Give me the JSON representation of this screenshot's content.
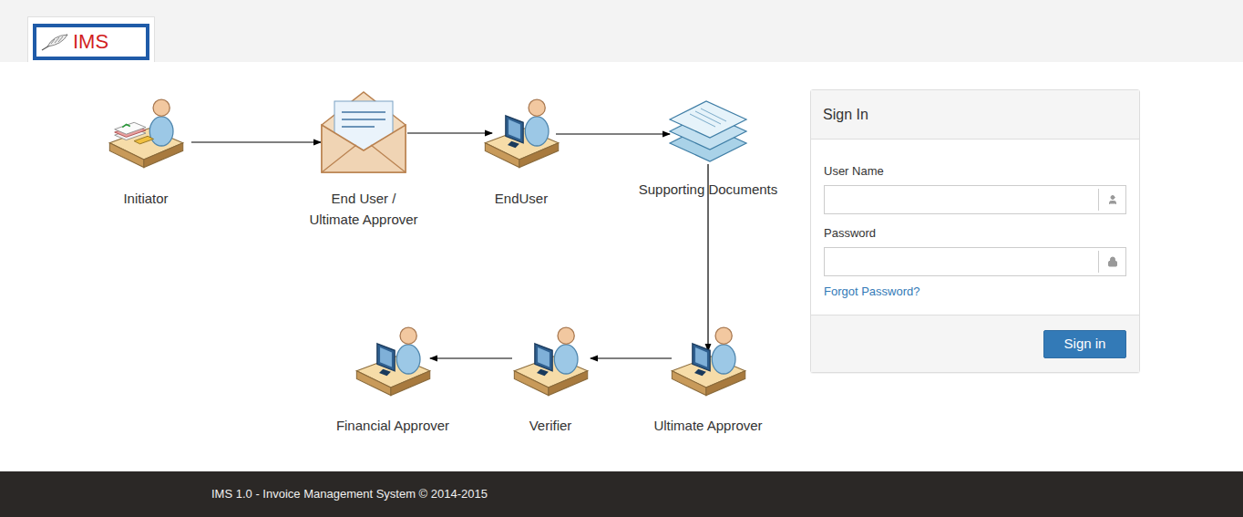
{
  "header": {
    "logo": "IMS"
  },
  "diagram": {
    "nodes": [
      {
        "label": [
          "Initiator"
        ],
        "kind": "initiator"
      },
      {
        "label": [
          "End User /",
          "Ultimate Approver"
        ],
        "kind": "envelope"
      },
      {
        "label": [
          "EndUser"
        ],
        "kind": "computer"
      },
      {
        "label": [
          "Supporting Documents"
        ],
        "kind": "documents"
      },
      {
        "label": [
          "Ultimate Approver"
        ],
        "kind": "computer"
      },
      {
        "label": [
          "Verifier"
        ],
        "kind": "computer"
      },
      {
        "label": [
          "Financial Approver"
        ],
        "kind": "computer"
      }
    ]
  },
  "sign_in": {
    "title": "Sign In",
    "fields": [
      {
        "label": "User Name",
        "value": "",
        "icon": "user"
      },
      {
        "label": "Password",
        "value": "",
        "icon": "lock"
      }
    ],
    "forgot_link": "Forgot Password?",
    "button": "Sign in"
  },
  "footer": "IMS 1.0 - Invoice Management System © 2014-2015"
}
